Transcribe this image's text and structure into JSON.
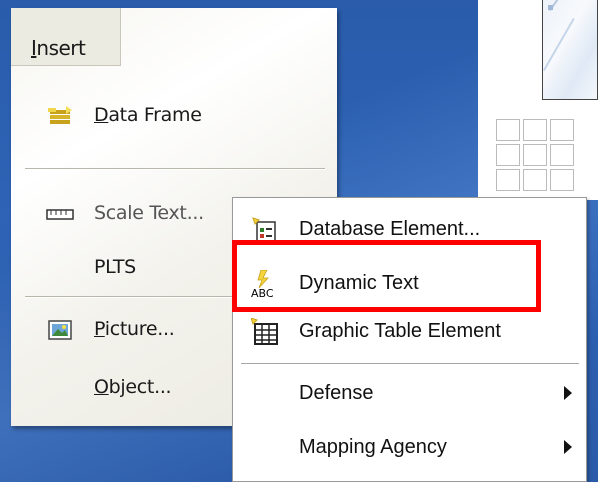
{
  "insert_menu": {
    "title": "Insert",
    "items": [
      {
        "label": "Data Frame",
        "icon": "data-frame-icon"
      },
      {
        "label": "Scale Text...",
        "icon": "scale-text-icon"
      },
      {
        "label": "PLTS",
        "icon": null
      },
      {
        "label": "Picture...",
        "icon": "picture-icon"
      },
      {
        "label": "Object...",
        "icon": null
      }
    ]
  },
  "submenu": {
    "items": [
      {
        "label": "Database Element...",
        "icon": "database-element-icon",
        "has_submenu": false
      },
      {
        "label": "Dynamic Text",
        "icon": "dynamic-text-icon",
        "has_submenu": false,
        "highlighted": true
      },
      {
        "label": "Graphic Table Element",
        "icon": "graphic-table-icon",
        "has_submenu": false
      },
      {
        "label": "Defense",
        "icon": null,
        "has_submenu": true
      },
      {
        "label": "Mapping Agency",
        "icon": null,
        "has_submenu": true
      }
    ]
  },
  "colors": {
    "highlight": "#ff0000",
    "background": "#2e63b5",
    "menu_bg": "#f6f5ef"
  }
}
